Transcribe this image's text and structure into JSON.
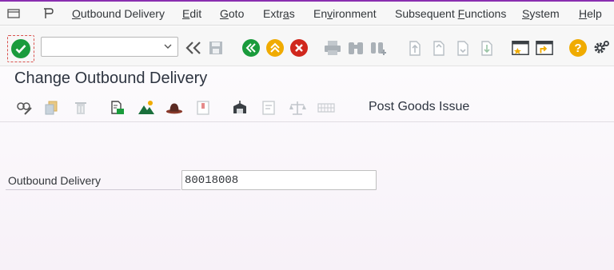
{
  "menubar": {
    "items": [
      {
        "label": "Outbound Delivery",
        "mnemonic_index": 0
      },
      {
        "label": "Edit",
        "mnemonic_index": 0
      },
      {
        "label": "Goto",
        "mnemonic_index": 0
      },
      {
        "label": "Extras",
        "mnemonic_index": 4
      },
      {
        "label": "Environment",
        "mnemonic_index": 2
      },
      {
        "label": "Subsequent Functions",
        "mnemonic_index": 11
      },
      {
        "label": "System",
        "mnemonic_index": 0
      },
      {
        "label": "Help",
        "mnemonic_index": 0
      }
    ],
    "icons": [
      "menu-icon",
      "transaction-icon"
    ]
  },
  "toolbar": {
    "command_field_value": "",
    "icons": [
      "enter-icon",
      "back-double-icon",
      "save-icon",
      "back-icon",
      "exit-icon",
      "cancel-icon",
      "print-icon",
      "find-icon",
      "find-next-icon",
      "first-page-icon",
      "previous-page-icon",
      "next-page-icon",
      "last-page-icon",
      "new-session-icon",
      "shortcut-icon",
      "help-icon",
      "settings-icon"
    ],
    "colors": {
      "green": "#1a9b3c",
      "orange": "#f0ab00",
      "red": "#d0271d",
      "grey": "#a9b1b8"
    }
  },
  "page": {
    "title": "Change Outbound Delivery"
  },
  "app_toolbar": {
    "icons": [
      "display-change-icon",
      "copy-icon",
      "delete-icon",
      "document-flow-icon",
      "mountain-icon",
      "hat-icon",
      "header-icon",
      "stock-icon",
      "item-icon",
      "balance-icon",
      "grid-icon"
    ],
    "post_goods_issue_label": "Post Goods Issue"
  },
  "form": {
    "outbound_delivery_label": "Outbound Delivery",
    "outbound_delivery_value": "80018008"
  }
}
